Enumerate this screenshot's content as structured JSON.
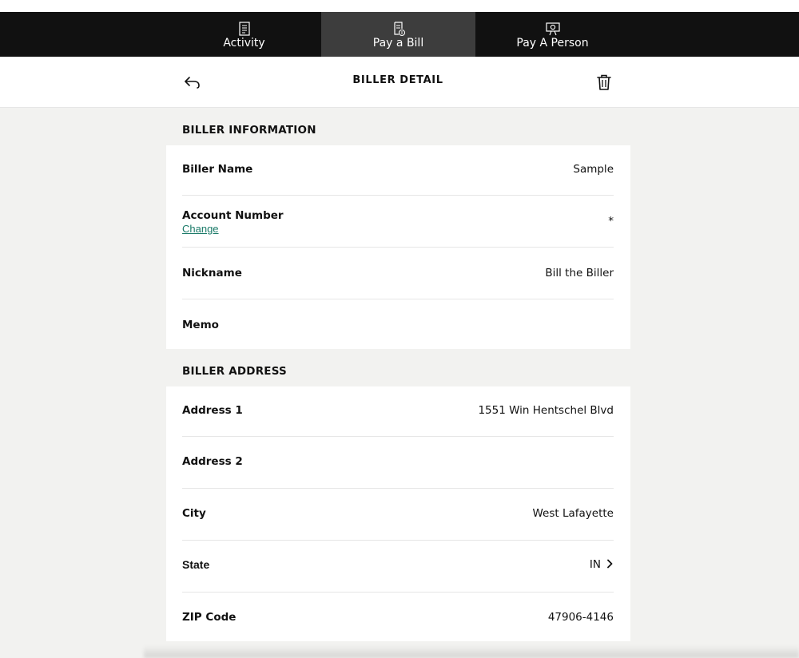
{
  "nav": {
    "tabs": [
      {
        "label": "Activity",
        "icon": "activity-icon",
        "active": false
      },
      {
        "label": "Pay a Bill",
        "icon": "bill-icon",
        "active": true
      },
      {
        "label": "Pay A Person",
        "icon": "person-payment-icon",
        "active": false
      }
    ]
  },
  "header": {
    "title": "BILLER DETAIL",
    "back_icon": "back-arrow-icon",
    "delete_icon": "trash-icon"
  },
  "biller_information": {
    "heading": "BILLER INFORMATION",
    "biller_name": {
      "label": "Biller Name",
      "value": "Sample"
    },
    "account_number": {
      "label": "Account Number",
      "value": "*",
      "change_link": "Change"
    },
    "nickname": {
      "label": "Nickname",
      "value": "Bill the Biller"
    },
    "memo": {
      "label": "Memo",
      "value": ""
    }
  },
  "biller_address": {
    "heading": "BILLER ADDRESS",
    "address1": {
      "label": "Address 1",
      "value": "1551 Win Hentschel Blvd"
    },
    "address2": {
      "label": "Address 2",
      "value": ""
    },
    "city": {
      "label": "City",
      "value": "West Lafayette"
    },
    "state": {
      "label": "State",
      "value": "IN"
    },
    "zip": {
      "label": "ZIP Code",
      "value": "47906-4146"
    }
  },
  "colors": {
    "nav_background": "#111111",
    "active_tab": "#3d3d3d",
    "page_background": "#f2f2f0",
    "link": "#1a7a68"
  }
}
